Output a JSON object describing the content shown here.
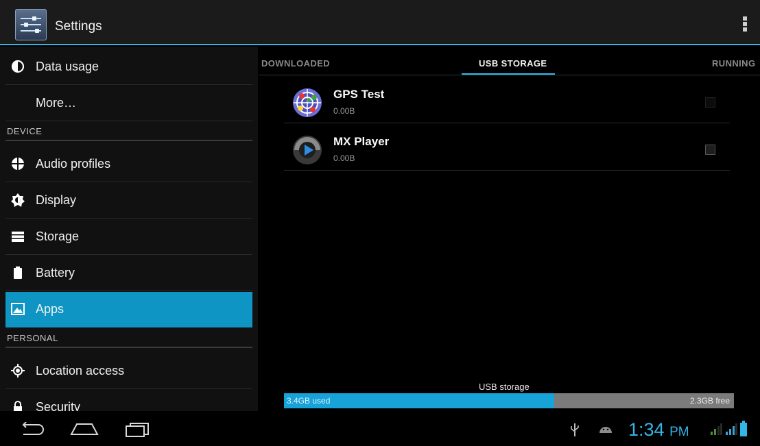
{
  "action_bar": {
    "title": "Settings"
  },
  "sidebar": {
    "items": [
      {
        "label": "Data usage",
        "icon": "data-usage-icon"
      },
      {
        "label": "More…",
        "icon": ""
      },
      {
        "header": "DEVICE"
      },
      {
        "label": "Audio profiles",
        "icon": "audio-profiles-icon"
      },
      {
        "label": "Display",
        "icon": "display-icon"
      },
      {
        "label": "Storage",
        "icon": "storage-icon"
      },
      {
        "label": "Battery",
        "icon": "battery-icon"
      },
      {
        "label": "Apps",
        "icon": "apps-icon",
        "selected": true
      },
      {
        "header": "PERSONAL"
      },
      {
        "label": "Location access",
        "icon": "location-icon"
      },
      {
        "label": "Security",
        "icon": "lock-icon"
      }
    ]
  },
  "tabs": [
    {
      "label": "DOWNLOADED"
    },
    {
      "label": "USB STORAGE",
      "selected": true
    },
    {
      "label": "RUNNING"
    }
  ],
  "apps": [
    {
      "name": "GPS Test",
      "size": "0.00B",
      "icon": "gps-test-icon"
    },
    {
      "name": "MX Player",
      "size": "0.00B",
      "icon": "mx-player-icon"
    }
  ],
  "storage": {
    "label": "USB storage",
    "used": "3.4GB used",
    "free": "2.3GB free",
    "used_fraction": 0.6
  },
  "status_bar": {
    "time": "1:34",
    "ampm": "PM"
  },
  "colors": {
    "accent": "#33b5e5",
    "selected_row": "#0e95c3"
  }
}
